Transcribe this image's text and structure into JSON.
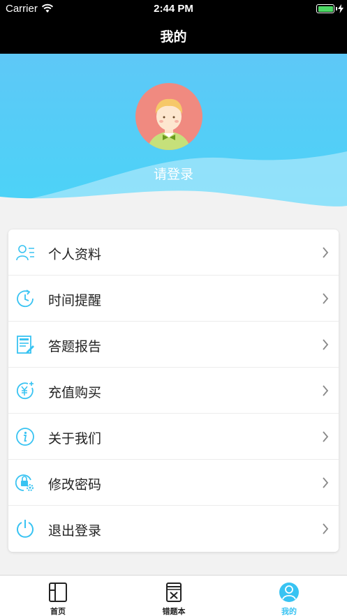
{
  "status_bar": {
    "carrier": "Carrier",
    "time": "2:44 PM"
  },
  "nav": {
    "title": "我的"
  },
  "profile": {
    "login_prompt": "请登录"
  },
  "menu": [
    {
      "label": "个人资料",
      "icon": "profile-icon"
    },
    {
      "label": "时间提醒",
      "icon": "clock-icon"
    },
    {
      "label": "答题报告",
      "icon": "report-icon"
    },
    {
      "label": "充值购买",
      "icon": "recharge-icon"
    },
    {
      "label": "关于我们",
      "icon": "info-icon"
    },
    {
      "label": "修改密码",
      "icon": "lock-icon"
    },
    {
      "label": "退出登录",
      "icon": "power-icon"
    }
  ],
  "tabs": [
    {
      "label": "首页",
      "icon": "book-icon"
    },
    {
      "label": "错题本",
      "icon": "wrong-book-icon"
    },
    {
      "label": "我的",
      "icon": "user-icon",
      "active": true
    }
  ],
  "colors": {
    "accent": "#38c3f2",
    "header_top": "#5ec8f7",
    "header_bottom": "#4bd3f7",
    "avatar_bg": "#f08a80"
  }
}
